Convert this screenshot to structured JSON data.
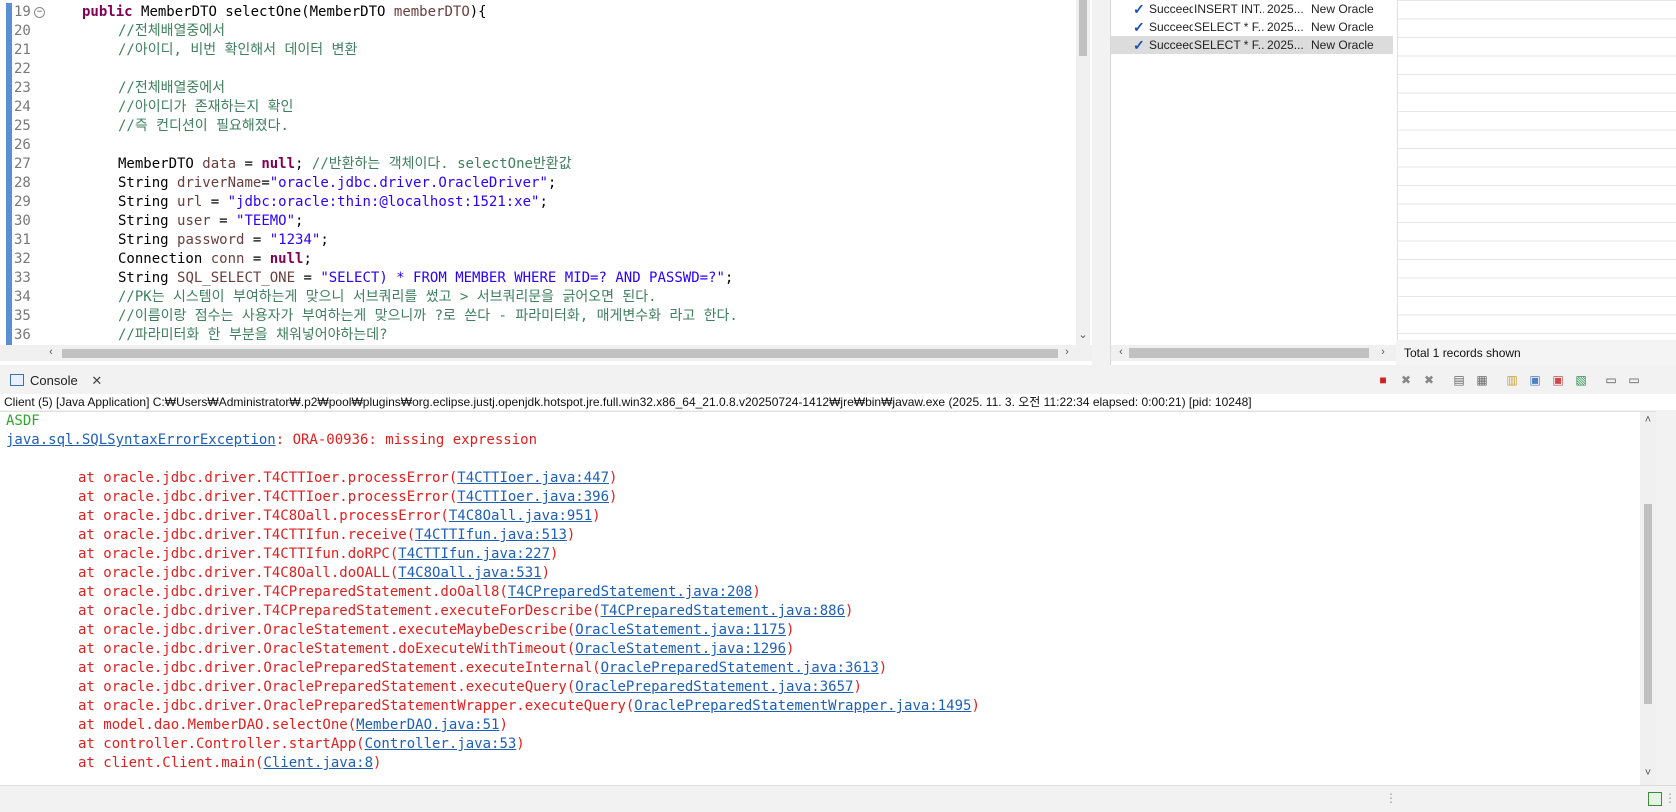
{
  "editor": {
    "lines": [
      {
        "no": "19",
        "fold": "⊖",
        "parts": [
          [
            "kw",
            "public "
          ],
          [
            "tx",
            "MemberDTO selectOne(MemberDTO "
          ],
          [
            "pm",
            "memberDTO"
          ],
          [
            "tx",
            "){"
          ]
        ],
        "indent": 0
      },
      {
        "no": "20",
        "parts": [
          [
            "cm",
            "//전체배열중에서"
          ]
        ],
        "indent": 1
      },
      {
        "no": "21",
        "parts": [
          [
            "cm",
            "//아이디, 비번 확인해서 데이터 변환"
          ]
        ],
        "indent": 1
      },
      {
        "no": "22",
        "parts": [],
        "indent": 1
      },
      {
        "no": "23",
        "parts": [
          [
            "cm",
            "//전체배열중에서"
          ]
        ],
        "indent": 1
      },
      {
        "no": "24",
        "parts": [
          [
            "cm",
            "//아이디가 존재하는지 확인"
          ]
        ],
        "indent": 1
      },
      {
        "no": "25",
        "parts": [
          [
            "cm",
            "//즉 컨디션이 필요해졌다."
          ]
        ],
        "indent": 1
      },
      {
        "no": "26",
        "parts": [],
        "indent": 1
      },
      {
        "no": "27",
        "parts": [
          [
            "tx",
            "MemberDTO "
          ],
          [
            "vr",
            "data"
          ],
          [
            "tx",
            " = "
          ],
          [
            "kw",
            "null"
          ],
          [
            "tx",
            "; "
          ],
          [
            "cm",
            "//반환하는 객체이다. selectOne반환값"
          ]
        ],
        "indent": 1
      },
      {
        "no": "28",
        "parts": [
          [
            "tx",
            "String "
          ],
          [
            "vr",
            "driverName"
          ],
          [
            "tx",
            "="
          ],
          [
            "st",
            "\"oracle.jdbc.driver.OracleDriver\""
          ],
          [
            "tx",
            ";"
          ]
        ],
        "indent": 1
      },
      {
        "no": "29",
        "parts": [
          [
            "tx",
            "String "
          ],
          [
            "vr",
            "url"
          ],
          [
            "tx",
            " = "
          ],
          [
            "st",
            "\"jdbc:oracle:thin:@localhost:1521:xe\""
          ],
          [
            "tx",
            ";"
          ]
        ],
        "indent": 1
      },
      {
        "no": "30",
        "parts": [
          [
            "tx",
            "String "
          ],
          [
            "vr",
            "user"
          ],
          [
            "tx",
            " = "
          ],
          [
            "st",
            "\"TEEMO\""
          ],
          [
            "tx",
            ";"
          ]
        ],
        "indent": 1
      },
      {
        "no": "31",
        "parts": [
          [
            "tx",
            "String "
          ],
          [
            "vr",
            "password"
          ],
          [
            "tx",
            " = "
          ],
          [
            "st",
            "\"1234\""
          ],
          [
            "tx",
            ";"
          ]
        ],
        "indent": 1
      },
      {
        "no": "32",
        "parts": [
          [
            "tx",
            "Connection "
          ],
          [
            "vr",
            "conn"
          ],
          [
            "tx",
            " = "
          ],
          [
            "kw",
            "null"
          ],
          [
            "tx",
            ";"
          ]
        ],
        "indent": 1
      },
      {
        "no": "33",
        "parts": [
          [
            "tx",
            "String "
          ],
          [
            "vr",
            "SQL_SELECT_ONE"
          ],
          [
            "tx",
            " = "
          ],
          [
            "st",
            "\"SELECT) * FROM MEMBER WHERE MID=? AND PASSWD=?\""
          ],
          [
            "tx",
            ";"
          ]
        ],
        "indent": 1
      },
      {
        "no": "34",
        "parts": [
          [
            "cm",
            "//PK는 시스템이 부여하는게 맞으니 서브쿼리를 썼고 > 서브쿼리문을 긁어오면 된다."
          ]
        ],
        "indent": 1
      },
      {
        "no": "35",
        "parts": [
          [
            "cm",
            "//이름이랑 점수는 사용자가 부여하는게 맞으니까 ?로 쓴다 - 파라미터화, 매게변수화 라고 한다."
          ]
        ],
        "indent": 1
      },
      {
        "no": "36",
        "parts": [
          [
            "cm",
            "//파라미터화 한 부분을 채워넣어야하는데?"
          ]
        ],
        "indent": 1
      }
    ]
  },
  "history": {
    "rows": [
      {
        "status": "Succeeded",
        "sql": "INSERT INT...",
        "date": "2025...",
        "conn": "New Oracle",
        "selected": false
      },
      {
        "status": "Succeeded",
        "sql": "SELECT * F...",
        "date": "2025...",
        "conn": "New Oracle",
        "selected": false
      },
      {
        "status": "Succeeded",
        "sql": "SELECT * F...",
        "date": "2025...",
        "conn": "New Oracle",
        "selected": true
      }
    ],
    "records_label": "Total 1 records shown"
  },
  "console": {
    "tab_label": "Console",
    "launch_info": "Client (5) [Java Application] C:₩Users₩Administrator₩.p2₩pool₩plugins₩org.eclipse.justj.openjdk.hotspot.jre.full.win32.x86_64_21.0.8.v20250724-1412₩jre₩bin₩javaw.exe  (2025. 11. 3. 오전 11:22:34 elapsed: 0:00:21) [pid: 10248]",
    "lines": [
      {
        "type": "green",
        "text": "ASDF"
      },
      {
        "type": "exception",
        "link": "java.sql.SQLSyntaxErrorException",
        "rest": ": ORA-00936: missing expression"
      },
      {
        "type": "blank"
      },
      {
        "type": "frame",
        "at": "at oracle.jdbc.driver.T4CTTIoer.processError(",
        "link": "T4CTTIoer.java:447"
      },
      {
        "type": "frame",
        "at": "at oracle.jdbc.driver.T4CTTIoer.processError(",
        "link": "T4CTTIoer.java:396"
      },
      {
        "type": "frame",
        "at": "at oracle.jdbc.driver.T4C8Oall.processError(",
        "link": "T4C8Oall.java:951"
      },
      {
        "type": "frame",
        "at": "at oracle.jdbc.driver.T4CTTIfun.receive(",
        "link": "T4CTTIfun.java:513"
      },
      {
        "type": "frame",
        "at": "at oracle.jdbc.driver.T4CTTIfun.doRPC(",
        "link": "T4CTTIfun.java:227"
      },
      {
        "type": "frame",
        "at": "at oracle.jdbc.driver.T4C8Oall.doOALL(",
        "link": "T4C8Oall.java:531"
      },
      {
        "type": "frame",
        "at": "at oracle.jdbc.driver.T4CPreparedStatement.doOall8(",
        "link": "T4CPreparedStatement.java:208"
      },
      {
        "type": "frame",
        "at": "at oracle.jdbc.driver.T4CPreparedStatement.executeForDescribe(",
        "link": "T4CPreparedStatement.java:886"
      },
      {
        "type": "frame",
        "at": "at oracle.jdbc.driver.OracleStatement.executeMaybeDescribe(",
        "link": "OracleStatement.java:1175"
      },
      {
        "type": "frame",
        "at": "at oracle.jdbc.driver.OracleStatement.doExecuteWithTimeout(",
        "link": "OracleStatement.java:1296"
      },
      {
        "type": "frame",
        "at": "at oracle.jdbc.driver.OraclePreparedStatement.executeInternal(",
        "link": "OraclePreparedStatement.java:3613"
      },
      {
        "type": "frame",
        "at": "at oracle.jdbc.driver.OraclePreparedStatement.executeQuery(",
        "link": "OraclePreparedStatement.java:3657"
      },
      {
        "type": "frame",
        "at": "at oracle.jdbc.driver.OraclePreparedStatementWrapper.executeQuery(",
        "link": "OraclePreparedStatementWrapper.java:1495"
      },
      {
        "type": "frame",
        "at": "at model.dao.MemberDAO.selectOne(",
        "link": "MemberDAO.java:51"
      },
      {
        "type": "frame",
        "at": "at controller.Controller.startApp(",
        "link": "Controller.java:53"
      },
      {
        "type": "frame",
        "at": "at client.Client.main(",
        "link": "Client.java:8"
      }
    ]
  },
  "colors": {
    "keyword": "#7f0055",
    "comment": "#3f7f5f",
    "string": "#2a00ff",
    "error": "#e02020",
    "link": "#1e5fb8",
    "accent": "#2f6fd6"
  },
  "toolbar_icons": [
    "terminate-icon",
    "remove-launch-icon",
    "remove-all-icon",
    "clear-console-icon",
    "scroll-lock-icon",
    "word-wrap-icon",
    "show-stdout-icon",
    "show-stderr-icon",
    "pin-console-icon",
    "display-console-icon",
    "open-console-icon"
  ]
}
